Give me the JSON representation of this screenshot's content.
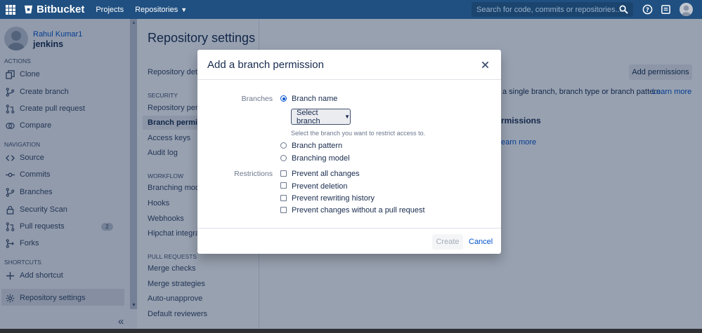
{
  "topbar": {
    "brand": "Bitbucket",
    "nav": [
      "Projects",
      "Repositories"
    ],
    "search_placeholder": "Search for code, commits or repositories..."
  },
  "sidebar": {
    "user": "Rahul Kumar1",
    "repo": "jenkins",
    "headings": {
      "actions": "ACTIONS",
      "navigation": "NAVIGATION",
      "shortcuts": "SHORTCUTS"
    },
    "actions": [
      "Clone",
      "Create branch",
      "Create pull request",
      "Compare"
    ],
    "navigation": [
      "Source",
      "Commits",
      "Branches",
      "Security Scan",
      "Pull requests",
      "Forks"
    ],
    "pull_requests_count": "2",
    "shortcuts": [
      "Add shortcut"
    ],
    "active": "Repository settings"
  },
  "main": {
    "title": "Repository settings",
    "nav": {
      "top": "Repository details",
      "security_heading": "SECURITY",
      "security": [
        "Repository permissions",
        "Branch permissions",
        "Access keys",
        "Audit log"
      ],
      "workflow_heading": "WORKFLOW",
      "workflow": [
        "Branching model",
        "Hooks",
        "Webhooks",
        "Hipchat integrations"
      ],
      "pull_requests_heading": "PULL REQUESTS",
      "pull_requests": [
        "Merge checks",
        "Merge strategies",
        "Auto-unapprove",
        "Default reviewers"
      ]
    },
    "add_permissions": "Add permissions",
    "desc_text": "a single branch, branch type or branch pattern.",
    "learn_more": "Learn more",
    "section_title": "rmissions",
    "learn_more2": "earn more"
  },
  "dialog": {
    "title": "Add a branch permission",
    "branches_label": "Branches",
    "branch_options": [
      "Branch name",
      "Branch pattern",
      "Branching model"
    ],
    "select_branch": "Select branch",
    "hint": "Select the branch you want to restrict access to.",
    "restrictions_label": "Restrictions",
    "restrictions": [
      "Prevent all changes",
      "Prevent deletion",
      "Prevent rewriting history",
      "Prevent changes without a pull request"
    ],
    "create": "Create",
    "cancel": "Cancel"
  },
  "colors": {
    "topbar": "#205081",
    "link": "#0052cc",
    "text": "#172b4d"
  }
}
